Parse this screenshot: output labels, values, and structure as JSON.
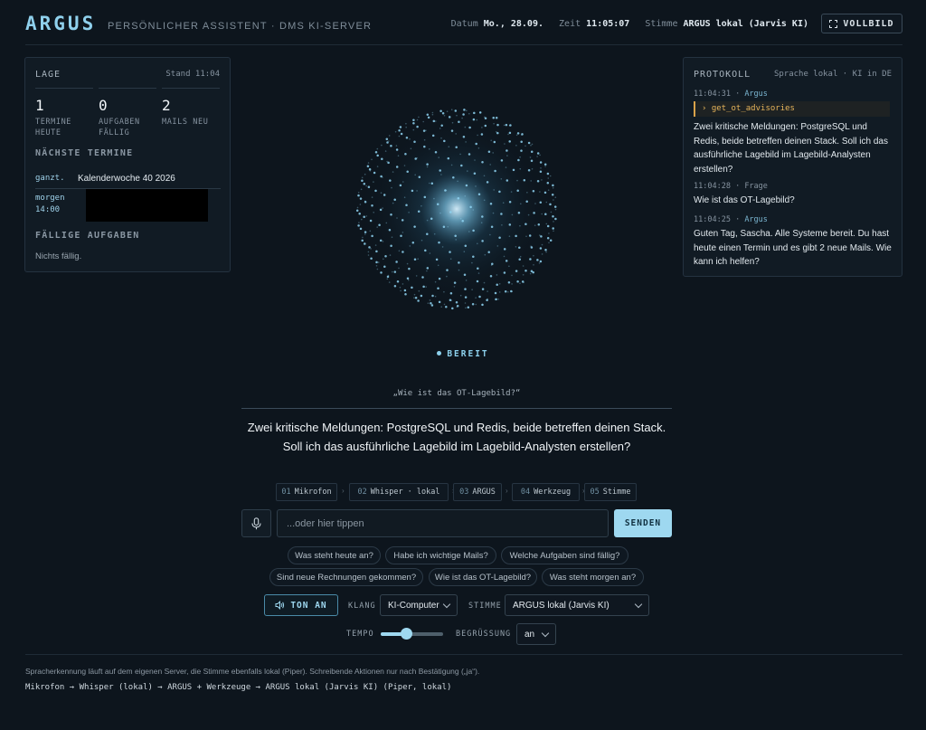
{
  "header": {
    "brand": "ARGUS",
    "subtitle": "PERSÖNLICHER ASSISTENT · DMS KI-SERVER",
    "date_label": "Datum",
    "date_value": "Mo., 28.09.",
    "time_label": "Zeit",
    "time_value": "11:05:07",
    "voice_label": "Stimme",
    "voice_value": "ARGUS lokal (Jarvis KI)",
    "fullscreen_label": "VOLLBILD"
  },
  "lage": {
    "title": "LAGE",
    "stand": "Stand 11:04",
    "stats": [
      {
        "value": "1",
        "label": "TERMINE HEUTE"
      },
      {
        "value": "0",
        "label": "AUFGABEN FÄLLIG"
      },
      {
        "value": "2",
        "label": "MAILS NEU"
      }
    ],
    "next_title": "NÄCHSTE TERMINE",
    "appointments": [
      {
        "when": "ganzt.",
        "what": "Kalenderwoche 40 2026"
      },
      {
        "when": "morgen 14:00",
        "what": ""
      }
    ],
    "tasks_title": "FÄLLIGE AUFGABEN",
    "tasks_empty": "Nichts fällig."
  },
  "protokoll": {
    "title": "PROTOKOLL",
    "meta": "Sprache lokal · KI in DE",
    "entries": [
      {
        "time": "11:04:31",
        "sep": " · ",
        "who": "Argus",
        "tool": "› get_ot_advisories",
        "text": "Zwei kritische Meldungen: PostgreSQL und Redis, beide betreffen deinen Stack. Soll ich das ausführliche Lagebild im Lagebild-Analysten erstellen?"
      },
      {
        "time": "11:04:28",
        "sep": " · ",
        "who": "Frage",
        "text": "Wie ist das OT-Lagebild?"
      },
      {
        "time": "11:04:25",
        "sep": " · ",
        "who": "Argus",
        "text": "Guten Tag, Sascha. Alle Systeme bereit. Du hast heute einen Termin und es gibt 2 neue Mails. Wie kann ich helfen?"
      }
    ]
  },
  "center": {
    "status": "BEREIT",
    "question": "„Wie ist das OT-Lagebild?“",
    "answer": "Zwei kritische Meldungen: PostgreSQL und Redis, beide betreffen deinen Stack. Soll ich das ausführliche Lagebild im Lagebild-Analysten erstellen?"
  },
  "pipeline": [
    {
      "num": "01",
      "label": "Mikrofon"
    },
    {
      "num": "02",
      "label": "Whisper · lokal"
    },
    {
      "num": "03",
      "label": "ARGUS"
    },
    {
      "num": "04",
      "label": "Werkzeug"
    },
    {
      "num": "05",
      "label": "Stimme"
    }
  ],
  "input": {
    "placeholder": "...oder hier tippen",
    "send_label": "SENDEN"
  },
  "suggestions": [
    "Was steht heute an?",
    "Habe ich wichtige Mails?",
    "Welche Aufgaben sind fällig?",
    "Sind neue Rechnungen gekommen?",
    "Wie ist das OT-Lagebild?",
    "Was steht morgen an?"
  ],
  "controls": {
    "sound_toggle": "TON AN",
    "klang_label": "KLANG",
    "klang_value": "KI-Computer",
    "stimme_label": "STIMME",
    "stimme_value": "ARGUS lokal (Jarvis KI)",
    "tempo_label": "TEMPO",
    "tempo_value": 0.4,
    "begruessung_label": "BEGRÜSSUNG",
    "begruessung_value": "an"
  },
  "footer": {
    "note": "Spracherkennung läuft auf dem eigenen Server, die Stimme ebenfalls lokal (Piper). Schreibende Aktionen nur nach Bestätigung („ja“).",
    "chain": "Mikrofon → Whisper (lokal) → ARGUS + Werkzeuge → ARGUS lokal (Jarvis KI) (Piper, lokal)"
  },
  "colors": {
    "accent": "#9ed8f0",
    "background": "#0d151d",
    "tool": "#e6b45a"
  }
}
